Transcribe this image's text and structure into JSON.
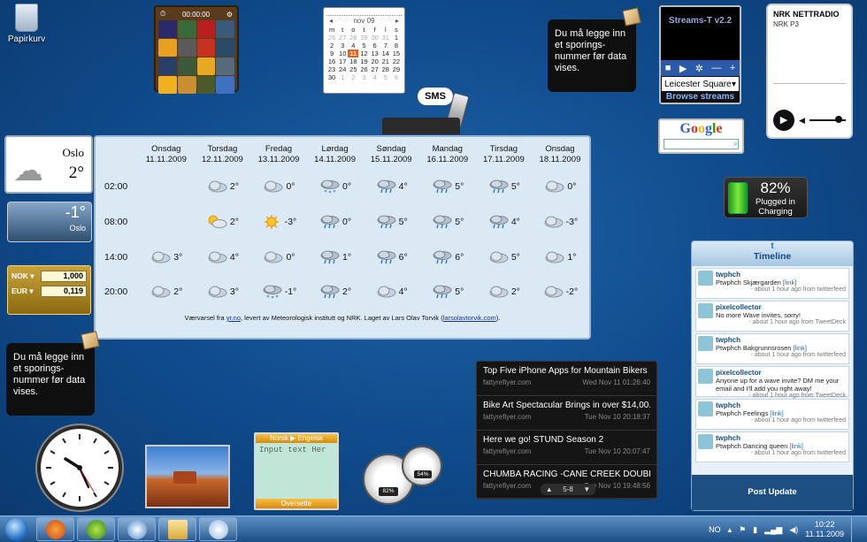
{
  "desktop": {
    "recycle_bin_label": "Papirkurv"
  },
  "puzzle": {
    "timer": "00:00:00"
  },
  "calendar": {
    "month": "nov 09",
    "weekday_headers": [
      "m",
      "t",
      "o",
      "t",
      "f",
      "l",
      "s"
    ],
    "weeks": [
      [
        "26",
        "27",
        "28",
        "29",
        "30",
        "31",
        "1"
      ],
      [
        "2",
        "3",
        "4",
        "5",
        "6",
        "7",
        "8"
      ],
      [
        "9",
        "10",
        "11",
        "12",
        "13",
        "14",
        "15"
      ],
      [
        "16",
        "17",
        "18",
        "19",
        "20",
        "21",
        "22"
      ],
      [
        "23",
        "24",
        "25",
        "26",
        "27",
        "28",
        "29"
      ],
      [
        "30",
        "1",
        "2",
        "3",
        "4",
        "5",
        "6"
      ]
    ],
    "today": "11"
  },
  "note": {
    "text": "Du må legge inn et sporings-nummer før data vises."
  },
  "streams": {
    "title": "Streams-T v2.2",
    "station": "Leicester Square",
    "browse": "Browse streams"
  },
  "nrk": {
    "logo": "NRK NETTRADIO",
    "channel": "NRK P3"
  },
  "sms": {
    "label": "SMS"
  },
  "google": {
    "logo": [
      "G",
      "o",
      "o",
      "g",
      "l",
      "e"
    ]
  },
  "battery": {
    "percent": "82%",
    "status_line1": "Plugged in",
    "status_line2": "Charging"
  },
  "weather_mini": {
    "city": "Oslo",
    "temp": "2°",
    "city2": "Oslo",
    "temp2": "-1°"
  },
  "forecast": {
    "days": [
      {
        "name": "Onsdag",
        "date": "11.11.2009"
      },
      {
        "name": "Torsdag",
        "date": "12.11.2009"
      },
      {
        "name": "Fredag",
        "date": "13.11.2009"
      },
      {
        "name": "Lørdag",
        "date": "14.11.2009"
      },
      {
        "name": "Søndag",
        "date": "15.11.2009"
      },
      {
        "name": "Mandag",
        "date": "16.11.2009"
      },
      {
        "name": "Tirsdag",
        "date": "17.11.2009"
      },
      {
        "name": "Onsdag",
        "date": "18.11.2009"
      }
    ],
    "rows": [
      {
        "time": "02:00",
        "cells": [
          {
            "icon": "",
            "temp": ""
          },
          {
            "icon": "cloud",
            "temp": "2°"
          },
          {
            "icon": "cloud",
            "temp": "0°"
          },
          {
            "icon": "snow",
            "temp": "0°"
          },
          {
            "icon": "rain",
            "temp": "4°"
          },
          {
            "icon": "rain",
            "temp": "5°"
          },
          {
            "icon": "rain",
            "temp": "5°"
          },
          {
            "icon": "cloud",
            "temp": "0°"
          }
        ]
      },
      {
        "time": "08:00",
        "cells": [
          {
            "icon": "",
            "temp": ""
          },
          {
            "icon": "sun-cloud",
            "temp": "2°"
          },
          {
            "icon": "sun",
            "temp": "-3°"
          },
          {
            "icon": "rain",
            "temp": "0°"
          },
          {
            "icon": "rain",
            "temp": "5°"
          },
          {
            "icon": "rain",
            "temp": "5°"
          },
          {
            "icon": "rain",
            "temp": "4°"
          },
          {
            "icon": "cloud",
            "temp": "-3°"
          }
        ]
      },
      {
        "time": "14:00",
        "cells": [
          {
            "icon": "cloud",
            "temp": "3°"
          },
          {
            "icon": "cloud",
            "temp": "4°"
          },
          {
            "icon": "cloud",
            "temp": "0°"
          },
          {
            "icon": "rain",
            "temp": "1°"
          },
          {
            "icon": "rain",
            "temp": "6°"
          },
          {
            "icon": "rain",
            "temp": "6°"
          },
          {
            "icon": "cloud",
            "temp": "5°"
          },
          {
            "icon": "cloud",
            "temp": "1°"
          }
        ]
      },
      {
        "time": "20:00",
        "cells": [
          {
            "icon": "cloud",
            "temp": "2°"
          },
          {
            "icon": "cloud",
            "temp": "3°"
          },
          {
            "icon": "snow",
            "temp": "-1°"
          },
          {
            "icon": "rain",
            "temp": "2°"
          },
          {
            "icon": "cloud",
            "temp": "4°"
          },
          {
            "icon": "rain",
            "temp": "5°"
          },
          {
            "icon": "cloud",
            "temp": "2°"
          },
          {
            "icon": "cloud",
            "temp": "-2°"
          }
        ]
      }
    ],
    "credit_prefix": "Værvarsel fra",
    "credit_link1": "yr.no",
    "credit_mid": ", levert av Meteorologisk institutt og NRK. Laget av Lars Olav Torvik (",
    "credit_link2": "larsolavtorvik.com",
    "credit_suffix": ")."
  },
  "currency": {
    "from": "NOK",
    "from_value": "1,000",
    "to": "EUR",
    "to_value": "0,119"
  },
  "translate": {
    "from_lang": "Norsk",
    "to_lang": "Engelsk",
    "input_placeholder": "Input text Her",
    "button": "Oversette"
  },
  "gauges": {
    "cpu": "82%",
    "ram": "54%"
  },
  "rss": {
    "items": [
      {
        "title": "Top Five iPhone Apps for Mountain Bikers",
        "source": "fattyrefiyer.com",
        "date": "Wed Nov 11 01:26:40"
      },
      {
        "title": "Bike Art Spectacular Brings in over $14,00...",
        "source": "fattyrefiyer.com",
        "date": "Tue Nov 10 20:18:37"
      },
      {
        "title": "Here we go! STUND Season 2",
        "source": "fattyrefiyer.com",
        "date": "Tue Nov 10 20:07:47"
      },
      {
        "title": "CHUMBA RACING -CANE CREEK DOUBLE ...",
        "source": "fattyrefiyer.com",
        "date": "Tue Nov 10 19:48:56"
      }
    ],
    "page": "5-8"
  },
  "twitter": {
    "header": "Timeline",
    "tweets": [
      {
        "user": "twphch",
        "text": "Ptwphch Skjærgarden",
        "link": "[link]",
        "time": "- about 1 hour ago from twitterfeed"
      },
      {
        "user": "pixelcollector",
        "text": "No more Wave invites, sorry!",
        "link": "",
        "time": "- about 1 hour ago from TweetDeck"
      },
      {
        "user": "twphch",
        "text": "Ptwphch Bakgrunnsrosen",
        "link": "[link]",
        "time": "- about 1 hour ago from twitterfeed"
      },
      {
        "user": "pixelcollector",
        "text": "Anyone up for a wave invite? DM me your email and I'll add you right away!",
        "link": "",
        "time": "- about 1 hour ago from TweetDeck"
      },
      {
        "user": "twphch",
        "text": "Ptwphch Feelings",
        "link": "[link]",
        "time": "- about 1 hour ago from twitterfeed"
      },
      {
        "user": "twphch",
        "text": "Ptwphch Dancing queen",
        "link": "[link]",
        "time": "- about 1 hour ago from twitterfeed"
      }
    ],
    "post_label": "Post Update"
  },
  "taskbar": {
    "lang": "NO",
    "time": "10:22",
    "date": "11.11.2009"
  },
  "colors": {
    "desktop": "#0f4a8a",
    "accent": "#e8601c"
  }
}
